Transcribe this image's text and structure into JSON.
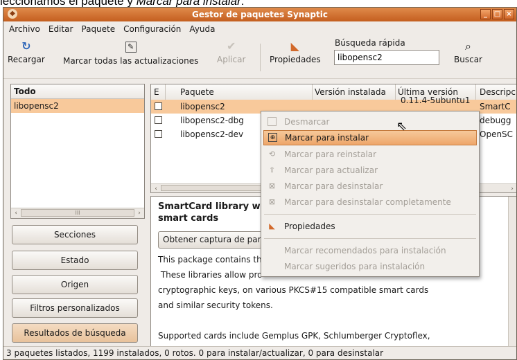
{
  "caption": {
    "prefix": "leccionamos el paquete y ",
    "emph": "Marcar para instalar",
    "suffix": ":"
  },
  "window": {
    "title": "Gestor de paquetes Synaptic",
    "app_icon": "synaptic-icon"
  },
  "menubar": [
    "Archivo",
    "Editar",
    "Paquete",
    "Configuración",
    "Ayuda"
  ],
  "toolbar": {
    "reload": "Recargar",
    "mark_all": "Marcar todas las actualizaciones",
    "apply": "Aplicar",
    "properties": "Propiedades",
    "quick_search_label": "Búsqueda rápida",
    "quick_search_value": "libopensc2",
    "search": "Buscar"
  },
  "filters": {
    "header": "Todo",
    "items": [
      "libopensc2"
    ]
  },
  "side_buttons": [
    "Secciones",
    "Estado",
    "Origen",
    "Filtros personalizados",
    "Resultados de búsqueda"
  ],
  "columns": [
    "E",
    "Paquete",
    "Versión instalada",
    "Última versión",
    "Descripción"
  ],
  "packages": [
    {
      "name": "libopensc2",
      "installed": "",
      "latest": "0.11.4-5ubuntu1",
      "desc": "SmartC"
    },
    {
      "name": "libopensc2-dbg",
      "installed": "",
      "latest": "",
      "desc": "debugg"
    },
    {
      "name": "libopensc2-dev",
      "installed": "",
      "latest": "",
      "desc": "OpenSC"
    }
  ],
  "description": {
    "title_line1": "SmartCard library w",
    "title_line2": "smart cards",
    "screenshot_button": "Obtener captura de pant",
    "lines": [
      "This package contains th",
      " These libraries allow pro",
      "cryptographic keys, on various PKCS#15 compatible smart cards",
      "and similar security tokens.",
      "",
      "Supported cards include Gemplus GPK, Schlumberger Cryptoflex,"
    ]
  },
  "status": "3 paquetes listados, 1199 instalados, 0 rotos. 0 para instalar/actualizar, 0 para desinstalar",
  "context_menu": {
    "unmark": "Desmarcar",
    "install": "Marcar para instalar",
    "reinstall": "Marcar para reinstalar",
    "upgrade": "Marcar para actualizar",
    "remove": "Marcar para desinstalar",
    "purge": "Marcar para desinstalar completamente",
    "properties": "Propiedades",
    "recommended": "Marcar recomendados para instalación",
    "suggested": "Marcar sugeridos para instalación"
  },
  "colors": {
    "selection": "#f8c99b",
    "titlebar": "#d2692b",
    "highlight": "#eea66a"
  }
}
